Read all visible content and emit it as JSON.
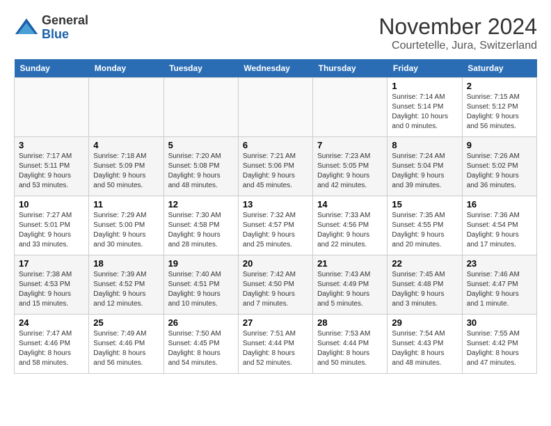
{
  "header": {
    "logo_line1": "General",
    "logo_line2": "Blue",
    "month": "November 2024",
    "location": "Courtetelle, Jura, Switzerland"
  },
  "weekdays": [
    "Sunday",
    "Monday",
    "Tuesday",
    "Wednesday",
    "Thursday",
    "Friday",
    "Saturday"
  ],
  "weeks": [
    [
      {
        "day": "",
        "info": ""
      },
      {
        "day": "",
        "info": ""
      },
      {
        "day": "",
        "info": ""
      },
      {
        "day": "",
        "info": ""
      },
      {
        "day": "",
        "info": ""
      },
      {
        "day": "1",
        "info": "Sunrise: 7:14 AM\nSunset: 5:14 PM\nDaylight: 10 hours\nand 0 minutes."
      },
      {
        "day": "2",
        "info": "Sunrise: 7:15 AM\nSunset: 5:12 PM\nDaylight: 9 hours\nand 56 minutes."
      }
    ],
    [
      {
        "day": "3",
        "info": "Sunrise: 7:17 AM\nSunset: 5:11 PM\nDaylight: 9 hours\nand 53 minutes."
      },
      {
        "day": "4",
        "info": "Sunrise: 7:18 AM\nSunset: 5:09 PM\nDaylight: 9 hours\nand 50 minutes."
      },
      {
        "day": "5",
        "info": "Sunrise: 7:20 AM\nSunset: 5:08 PM\nDaylight: 9 hours\nand 48 minutes."
      },
      {
        "day": "6",
        "info": "Sunrise: 7:21 AM\nSunset: 5:06 PM\nDaylight: 9 hours\nand 45 minutes."
      },
      {
        "day": "7",
        "info": "Sunrise: 7:23 AM\nSunset: 5:05 PM\nDaylight: 9 hours\nand 42 minutes."
      },
      {
        "day": "8",
        "info": "Sunrise: 7:24 AM\nSunset: 5:04 PM\nDaylight: 9 hours\nand 39 minutes."
      },
      {
        "day": "9",
        "info": "Sunrise: 7:26 AM\nSunset: 5:02 PM\nDaylight: 9 hours\nand 36 minutes."
      }
    ],
    [
      {
        "day": "10",
        "info": "Sunrise: 7:27 AM\nSunset: 5:01 PM\nDaylight: 9 hours\nand 33 minutes."
      },
      {
        "day": "11",
        "info": "Sunrise: 7:29 AM\nSunset: 5:00 PM\nDaylight: 9 hours\nand 30 minutes."
      },
      {
        "day": "12",
        "info": "Sunrise: 7:30 AM\nSunset: 4:58 PM\nDaylight: 9 hours\nand 28 minutes."
      },
      {
        "day": "13",
        "info": "Sunrise: 7:32 AM\nSunset: 4:57 PM\nDaylight: 9 hours\nand 25 minutes."
      },
      {
        "day": "14",
        "info": "Sunrise: 7:33 AM\nSunset: 4:56 PM\nDaylight: 9 hours\nand 22 minutes."
      },
      {
        "day": "15",
        "info": "Sunrise: 7:35 AM\nSunset: 4:55 PM\nDaylight: 9 hours\nand 20 minutes."
      },
      {
        "day": "16",
        "info": "Sunrise: 7:36 AM\nSunset: 4:54 PM\nDaylight: 9 hours\nand 17 minutes."
      }
    ],
    [
      {
        "day": "17",
        "info": "Sunrise: 7:38 AM\nSunset: 4:53 PM\nDaylight: 9 hours\nand 15 minutes."
      },
      {
        "day": "18",
        "info": "Sunrise: 7:39 AM\nSunset: 4:52 PM\nDaylight: 9 hours\nand 12 minutes."
      },
      {
        "day": "19",
        "info": "Sunrise: 7:40 AM\nSunset: 4:51 PM\nDaylight: 9 hours\nand 10 minutes."
      },
      {
        "day": "20",
        "info": "Sunrise: 7:42 AM\nSunset: 4:50 PM\nDaylight: 9 hours\nand 7 minutes."
      },
      {
        "day": "21",
        "info": "Sunrise: 7:43 AM\nSunset: 4:49 PM\nDaylight: 9 hours\nand 5 minutes."
      },
      {
        "day": "22",
        "info": "Sunrise: 7:45 AM\nSunset: 4:48 PM\nDaylight: 9 hours\nand 3 minutes."
      },
      {
        "day": "23",
        "info": "Sunrise: 7:46 AM\nSunset: 4:47 PM\nDaylight: 9 hours\nand 1 minute."
      }
    ],
    [
      {
        "day": "24",
        "info": "Sunrise: 7:47 AM\nSunset: 4:46 PM\nDaylight: 8 hours\nand 58 minutes."
      },
      {
        "day": "25",
        "info": "Sunrise: 7:49 AM\nSunset: 4:46 PM\nDaylight: 8 hours\nand 56 minutes."
      },
      {
        "day": "26",
        "info": "Sunrise: 7:50 AM\nSunset: 4:45 PM\nDaylight: 8 hours\nand 54 minutes."
      },
      {
        "day": "27",
        "info": "Sunrise: 7:51 AM\nSunset: 4:44 PM\nDaylight: 8 hours\nand 52 minutes."
      },
      {
        "day": "28",
        "info": "Sunrise: 7:53 AM\nSunset: 4:44 PM\nDaylight: 8 hours\nand 50 minutes."
      },
      {
        "day": "29",
        "info": "Sunrise: 7:54 AM\nSunset: 4:43 PM\nDaylight: 8 hours\nand 48 minutes."
      },
      {
        "day": "30",
        "info": "Sunrise: 7:55 AM\nSunset: 4:42 PM\nDaylight: 8 hours\nand 47 minutes."
      }
    ]
  ]
}
